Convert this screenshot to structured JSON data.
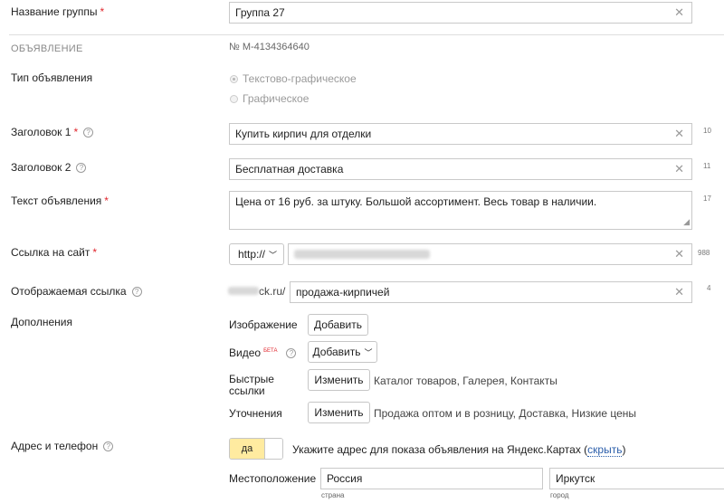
{
  "group": {
    "label": "Название группы",
    "value": "Группа 27"
  },
  "ad_section": {
    "title": "ОБЪЯВЛЕНИЕ",
    "number": "№ М-4134364640"
  },
  "ad_type": {
    "label": "Тип объявления",
    "options": [
      "Текстово-графическое",
      "Графическое"
    ],
    "selected": "Текстово-графическое"
  },
  "title1": {
    "label": "Заголовок 1",
    "value": "Купить кирпич для отделки",
    "counter": "10"
  },
  "title2": {
    "label": "Заголовок 2",
    "value": "Бесплатная доставка",
    "counter": "11"
  },
  "text": {
    "label": "Текст объявления",
    "value": "Цена от 16 руб. за штуку. Большой ассортимент. Весь товар в наличии.",
    "counter": "17"
  },
  "site_link": {
    "label": "Ссылка на сайт",
    "protocol": "http://",
    "counter": "988"
  },
  "display_link": {
    "label": "Отображаемая ссылка",
    "domain_suffix": "ck.ru/",
    "value": "продажа-кирпичей",
    "counter": "4"
  },
  "extras": {
    "label": "Дополнения",
    "image": {
      "label": "Изображение",
      "button": "Добавить"
    },
    "video": {
      "label": "Видео",
      "badge": "БЕТА",
      "button": "Добавить"
    },
    "quick_links": {
      "label_line1": "Быстрые",
      "label_line2": "ссылки",
      "button": "Изменить",
      "value": "Каталог товаров, Галерея, Контакты"
    },
    "clarifications": {
      "label": "Уточнения",
      "button": "Изменить",
      "value": "Продажа оптом и в розницу, Доставка, Низкие цены"
    }
  },
  "address": {
    "label": "Адрес и телефон",
    "toggle_label": "да",
    "description": "Укажите адрес для показа объявления на Яндекс.Картах",
    "hide_link": "скрыть",
    "location_label": "Местоположение",
    "country_value": "Россия",
    "country_hint": "страна",
    "city_value": "Иркутск",
    "city_hint": "город"
  },
  "colors": {
    "required": "#e0262d",
    "toggle_on": "#ffeba0",
    "link": "#2b5eaa"
  }
}
